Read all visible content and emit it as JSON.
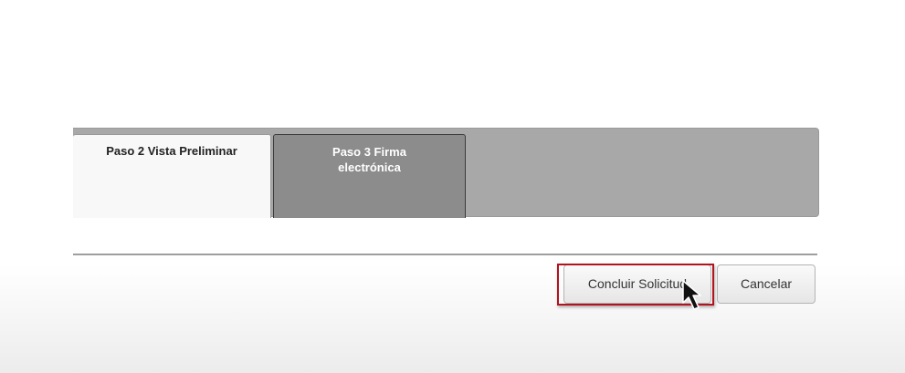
{
  "tabs": {
    "step2_label": "Paso 2 Vista Preliminar",
    "step3_label": "Paso 3 Firma electrónica"
  },
  "actions": {
    "conclude_label": "Concluir Solicitud",
    "cancel_label": "Cancelar"
  },
  "icons": {
    "cursor": "mouse-pointer-icon"
  },
  "colors": {
    "highlight": "#b3121f",
    "tab_bar": "#a8a8a8",
    "inactive_tab": "#8c8c8c"
  }
}
